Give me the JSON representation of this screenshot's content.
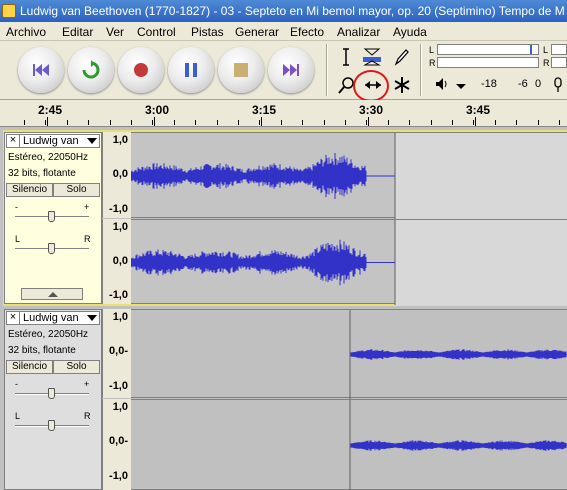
{
  "window": {
    "title": "Ludwig van Beethoven (1770-1827) - 03 - Septeto en Mi bemol mayor, op. 20 (Septimino) Tempo de M"
  },
  "menu": {
    "items": [
      "Archivo",
      "Editar",
      "Ver",
      "Control",
      "Pistas",
      "Generar",
      "Efecto",
      "Analizar",
      "Ayuda"
    ]
  },
  "transport": {
    "buttons": [
      "skip-to-start",
      "play-loop",
      "record",
      "pause",
      "stop",
      "skip-to-end"
    ]
  },
  "tools": {
    "names": [
      "selection-tool-icon",
      "envelope-tool-icon",
      "draw-tool-icon",
      "zoom-tool-icon",
      "timeshift-tool-icon",
      "multi-tool-icon"
    ],
    "active": "timeshift-tool-icon"
  },
  "meters": {
    "channel_left": "L",
    "channel_right": "R",
    "scale_1": "-18",
    "scale_2": "-6",
    "scale_3": "0"
  },
  "ruler": {
    "labels": [
      "2:45",
      "3:00",
      "3:15",
      "3:30",
      "3:45"
    ]
  },
  "tracks": [
    {
      "name": "Ludwig van",
      "info_line1": "Estéreo, 22050Hz",
      "info_line2": "32 bits, flotante",
      "mute_label": "Silencio",
      "solo_label": "Solo",
      "gain_minus": "-",
      "gain_plus": "+",
      "pan_left": "L",
      "pan_right": "R",
      "gain": 0.5,
      "pan": 0.5,
      "channels": [
        {
          "scale_top": "1,0",
          "scale_mid": "0,0",
          "scale_bot": "-1,0"
        },
        {
          "scale_top": "1,0",
          "scale_mid": "0,0",
          "scale_bot": "-1,0"
        }
      ]
    },
    {
      "name": "Ludwig van",
      "info_line1": "Estéreo, 22050Hz",
      "info_line2": "32 bits, flotante",
      "mute_label": "Silencio",
      "solo_label": "Solo",
      "gain_minus": "-",
      "gain_plus": "+",
      "pan_left": "L",
      "pan_right": "R",
      "gain": 0.5,
      "pan": 0.5,
      "channels": [
        {
          "scale_top": "1,0",
          "scale_mid": "0,0-",
          "scale_bot": "-1,0"
        },
        {
          "scale_top": "1,0",
          "scale_mid": "0,0-",
          "scale_bot": "-1,0"
        }
      ]
    }
  ],
  "colors": {
    "waveform": "#3232c8",
    "selection_border": "#e8e070",
    "title_bar": "#2a62c0",
    "highlight_ring": "#e01818"
  }
}
